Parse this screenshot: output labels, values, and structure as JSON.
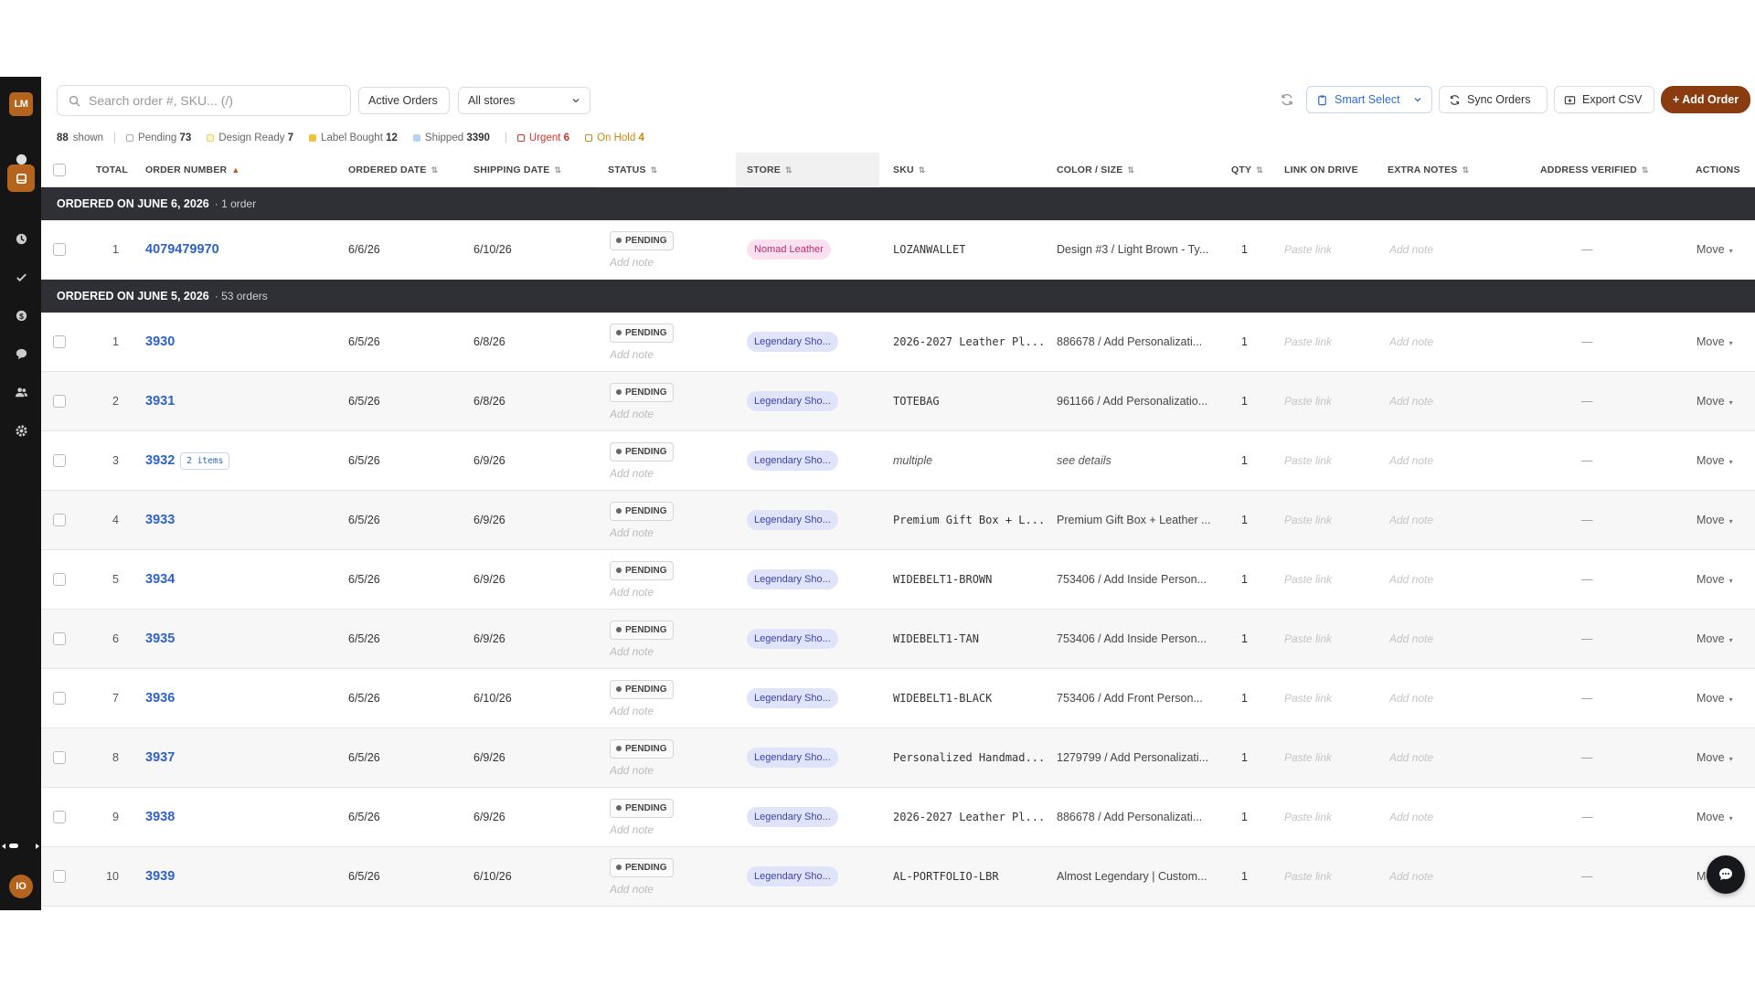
{
  "sidebar": {
    "logo": "LM",
    "user_initials": "IO",
    "icons": [
      "dashboard-icon",
      "orders-icon",
      "history-icon",
      "check-icon",
      "dollar-icon",
      "chat-icon",
      "users-icon",
      "settings-icon"
    ]
  },
  "toolbar": {
    "search_placeholder": "Search order #, SKU... (/)",
    "filter_label": "Active Orders",
    "stores_label": "All stores",
    "smart_select": "Smart Select",
    "sync_orders": "Sync Orders",
    "export_csv": "Export CSV",
    "add_order": "+ Add Order"
  },
  "status_bar": {
    "shown_count": "88",
    "shown_label": "shown",
    "pending_label": "Pending",
    "pending_count": "73",
    "design_ready_label": "Design Ready",
    "design_ready_count": "7",
    "label_bought_label": "Label Bought",
    "label_bought_count": "12",
    "shipped_label": "Shipped",
    "shipped_count": "3390",
    "urgent_label": "Urgent",
    "urgent_count": "6",
    "on_hold_label": "On Hold",
    "on_hold_count": "4"
  },
  "columns": {
    "total": "TOTAL",
    "order_number": "ORDER NUMBER",
    "ordered_date": "ORDERED DATE",
    "shipping_date": "SHIPPING DATE",
    "status": "STATUS",
    "store": "STORE",
    "sku": "SKU",
    "color_size": "COLOR / SIZE",
    "qty": "QTY",
    "link_on_drive": "LINK ON DRIVE",
    "extra_notes": "EXTRA NOTES",
    "address_verified": "ADDRESS VERIFIED",
    "actions": "ACTIONS"
  },
  "groups": [
    {
      "title": "ORDERED ON JUNE 6, 2026",
      "count": "· 1 order",
      "rows": [
        {
          "idx": "1",
          "order": "4079479970",
          "ordered": "6/6/26",
          "shipping": "6/10/26",
          "status": "PENDING",
          "note": "Add note",
          "store": "Nomad Leather",
          "store_type": "nomad",
          "sku": "LOZANWALLET",
          "sku_italic": false,
          "color": "Design #3 / Light Brown - Ty...",
          "color_italic": false,
          "qty": "1",
          "link": "Paste link",
          "extra": "Add note",
          "verified": "—",
          "action": "Move"
        }
      ]
    },
    {
      "title": "ORDERED ON JUNE 5, 2026",
      "count": "· 53 orders",
      "rows": [
        {
          "idx": "1",
          "order": "3930",
          "ordered": "6/5/26",
          "shipping": "6/8/26",
          "status": "PENDING",
          "note": "Add note",
          "store": "Legendary Sho...",
          "store_type": "leg",
          "sku": "2026-2027 Leather Pl...",
          "sku_italic": false,
          "color": "886678 / Add Personalizati...",
          "color_italic": false,
          "qty": "1",
          "link": "Paste link",
          "extra": "Add note",
          "verified": "—",
          "action": "Move"
        },
        {
          "idx": "2",
          "order": "3931",
          "ordered": "6/5/26",
          "shipping": "6/8/26",
          "status": "PENDING",
          "note": "Add note",
          "store": "Legendary Sho...",
          "store_type": "leg",
          "sku": "TOTEBAG",
          "sku_italic": false,
          "color": "961166 / Add Personalizatio...",
          "color_italic": false,
          "qty": "1",
          "link": "Paste link",
          "extra": "Add note",
          "verified": "—",
          "action": "Move"
        },
        {
          "idx": "3",
          "order": "3932",
          "items": "2 items",
          "ordered": "6/5/26",
          "shipping": "6/9/26",
          "status": "PENDING",
          "note": "Add note",
          "store": "Legendary Sho...",
          "store_type": "leg",
          "sku": "multiple",
          "sku_italic": true,
          "color": "see details",
          "color_italic": true,
          "qty": "1",
          "link": "Paste link",
          "extra": "Add note",
          "verified": "—",
          "action": "Move"
        },
        {
          "idx": "4",
          "order": "3933",
          "ordered": "6/5/26",
          "shipping": "6/9/26",
          "status": "PENDING",
          "note": "Add note",
          "store": "Legendary Sho...",
          "store_type": "leg",
          "sku": "Premium Gift Box + L...",
          "sku_italic": false,
          "color": "Premium Gift Box + Leather ...",
          "color_italic": false,
          "qty": "1",
          "link": "Paste link",
          "extra": "Add note",
          "verified": "—",
          "action": "Move"
        },
        {
          "idx": "5",
          "order": "3934",
          "ordered": "6/5/26",
          "shipping": "6/9/26",
          "status": "PENDING",
          "note": "Add note",
          "store": "Legendary Sho...",
          "store_type": "leg",
          "sku": "WIDEBELT1-BROWN",
          "sku_italic": false,
          "color": "753406 / Add Inside Person...",
          "color_italic": false,
          "qty": "1",
          "link": "Paste link",
          "extra": "Add note",
          "verified": "—",
          "action": "Move"
        },
        {
          "idx": "6",
          "order": "3935",
          "ordered": "6/5/26",
          "shipping": "6/9/26",
          "status": "PENDING",
          "note": "Add note",
          "store": "Legendary Sho...",
          "store_type": "leg",
          "sku": "WIDEBELT1-TAN",
          "sku_italic": false,
          "color": "753406 / Add Inside Person...",
          "color_italic": false,
          "qty": "1",
          "link": "Paste link",
          "extra": "Add note",
          "verified": "—",
          "action": "Move"
        },
        {
          "idx": "7",
          "order": "3936",
          "ordered": "6/5/26",
          "shipping": "6/10/26",
          "status": "PENDING",
          "note": "Add note",
          "store": "Legendary Sho...",
          "store_type": "leg",
          "sku": "WIDEBELT1-BLACK",
          "sku_italic": false,
          "color": "753406 / Add Front Person...",
          "color_italic": false,
          "qty": "1",
          "link": "Paste link",
          "extra": "Add note",
          "verified": "—",
          "action": "Move"
        },
        {
          "idx": "8",
          "order": "3937",
          "ordered": "6/5/26",
          "shipping": "6/9/26",
          "status": "PENDING",
          "note": "Add note",
          "store": "Legendary Sho...",
          "store_type": "leg",
          "sku": "Personalized Handmad...",
          "sku_italic": false,
          "color": "1279799 / Add Personalizati...",
          "color_italic": false,
          "qty": "1",
          "link": "Paste link",
          "extra": "Add note",
          "verified": "—",
          "action": "Move"
        },
        {
          "idx": "9",
          "order": "3938",
          "ordered": "6/5/26",
          "shipping": "6/9/26",
          "status": "PENDING",
          "note": "Add note",
          "store": "Legendary Sho...",
          "store_type": "leg",
          "sku": "2026-2027 Leather Pl...",
          "sku_italic": false,
          "color": "886678 / Add Personalizati...",
          "color_italic": false,
          "qty": "1",
          "link": "Paste link",
          "extra": "Add note",
          "verified": "—",
          "action": "Move"
        },
        {
          "idx": "10",
          "order": "3939",
          "ordered": "6/5/26",
          "shipping": "6/10/26",
          "status": "PENDING",
          "note": "Add note",
          "store": "Legendary Sho...",
          "store_type": "leg",
          "sku": "AL-PORTFOLIO-LBR",
          "sku_italic": false,
          "color": "Almost Legendary | Custom...",
          "color_italic": false,
          "qty": "1",
          "link": "Paste link",
          "extra": "Add note",
          "verified": "—",
          "action": "Move"
        }
      ]
    }
  ],
  "colors": {
    "brand": "#b4641c",
    "add_button": "#8a3b10",
    "link_blue": "#2f62c9",
    "group_bar": "#2e3035",
    "urgent": "#d0342c",
    "on_hold": "#c98a0c"
  }
}
